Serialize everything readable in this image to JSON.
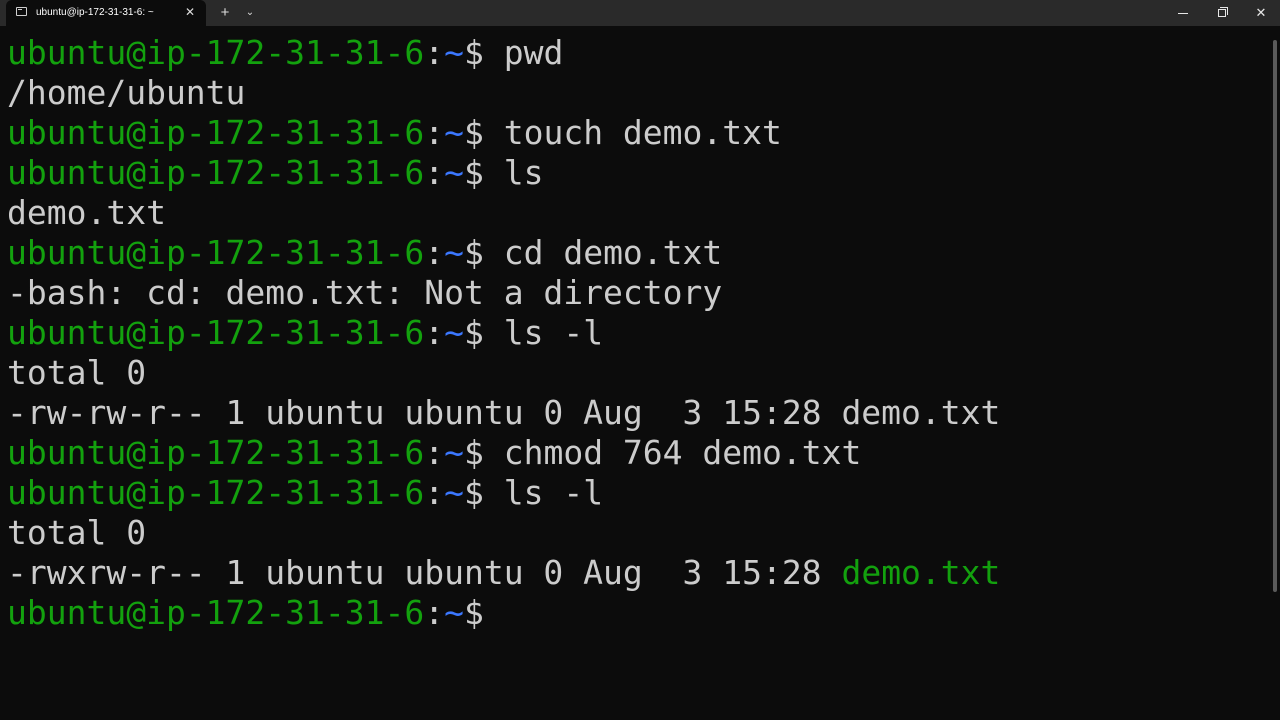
{
  "titlebar": {
    "tab_title": "ubuntu@ip-172-31-31-6: ~",
    "tab_close_glyph": "✕",
    "new_tab_glyph": "+",
    "dropdown_glyph": "⌄",
    "close_window_glyph": "✕"
  },
  "prompt": {
    "user_host": "ubuntu@ip-172-31-31-6",
    "colon": ":",
    "path": "~",
    "dollar": "$"
  },
  "lines": [
    {
      "kind": "prompt",
      "cmd": " pwd"
    },
    {
      "kind": "output",
      "text": "/home/ubuntu"
    },
    {
      "kind": "prompt",
      "cmd": " touch demo.txt"
    },
    {
      "kind": "prompt",
      "cmd": " ls"
    },
    {
      "kind": "output",
      "text": "demo.txt"
    },
    {
      "kind": "prompt",
      "cmd": " cd demo.txt"
    },
    {
      "kind": "output",
      "text": "-bash: cd: demo.txt: Not a directory"
    },
    {
      "kind": "prompt",
      "cmd": " ls -l"
    },
    {
      "kind": "output",
      "text": "total 0"
    },
    {
      "kind": "output",
      "text": "-rw-rw-r-- 1 ubuntu ubuntu 0 Aug  3 15:28 demo.txt"
    },
    {
      "kind": "prompt",
      "cmd": " chmod 764 demo.txt"
    },
    {
      "kind": "prompt",
      "cmd": " ls -l"
    },
    {
      "kind": "output",
      "text": "total 0"
    },
    {
      "kind": "listing",
      "text": "-rwxrw-r-- 1 ubuntu ubuntu 0 Aug  3 15:28 ",
      "exec_file": "demo.txt"
    },
    {
      "kind": "prompt",
      "cmd": ""
    }
  ],
  "colors": {
    "background": "#0c0c0c",
    "titlebar": "#2a2a2a",
    "prompt_user": "#13a10e",
    "prompt_path": "#3b78ff",
    "foreground": "#cccccc",
    "executable": "#13a10e"
  },
  "icons": {
    "tab": "terminal-icon",
    "tab_close": "close-icon",
    "new_tab": "plus-icon",
    "dropdown": "chevron-down-icon",
    "minimize": "minimize-icon",
    "maximize": "restore-icon",
    "close": "close-icon"
  }
}
